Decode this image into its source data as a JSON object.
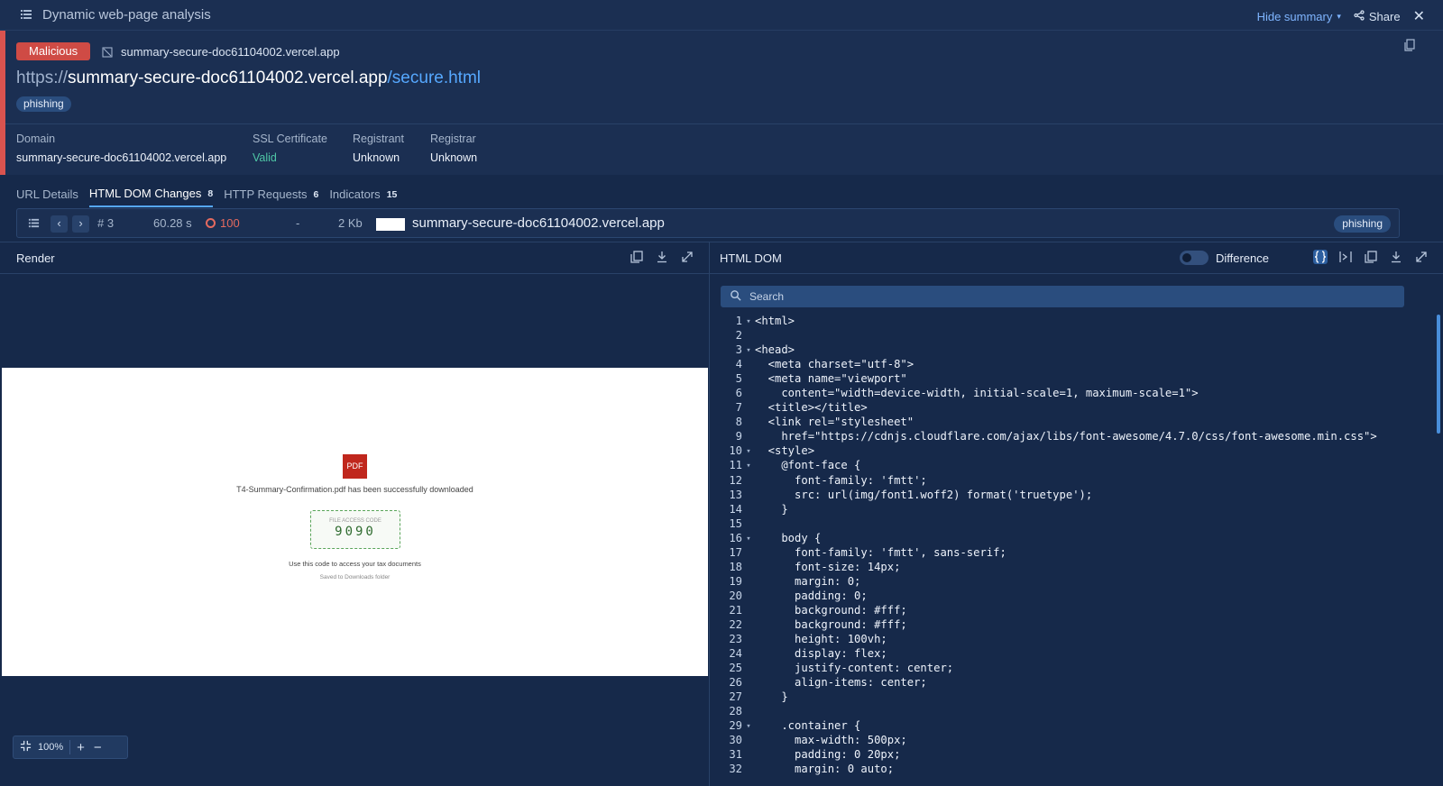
{
  "window": {
    "title": "Dynamic web-page analysis",
    "hide_summary": "Hide summary",
    "share": "Share",
    "colors": {
      "accent": "#56a8ff",
      "malicious": "#cf4b45",
      "valid": "#4fc7a6"
    }
  },
  "summary": {
    "verdict": "Malicious",
    "host": "summary-secure-doc61104002.vercel.app",
    "url_scheme": "https://",
    "url_host": "summary-secure-doc61104002.vercel.app",
    "url_path": "/secure.html",
    "tag": "phishing",
    "fields": [
      {
        "label": "Domain",
        "value": "summary-secure-doc61104002.vercel.app"
      },
      {
        "label": "SSL Certificate",
        "value": "Valid"
      },
      {
        "label": "Registrant",
        "value": "Unknown"
      },
      {
        "label": "Registrar",
        "value": "Unknown"
      }
    ]
  },
  "tabs": [
    {
      "label": "URL Details",
      "count": ""
    },
    {
      "label": "HTML DOM Changes",
      "count": "8"
    },
    {
      "label": "HTTP Requests",
      "count": "6"
    },
    {
      "label": "Indicators",
      "count": "15"
    }
  ],
  "navrow": {
    "index": "# 3",
    "time": "60.28 s",
    "score": "100",
    "dash": "-",
    "size": "2 Kb",
    "host": "summary-secure-doc61104002.vercel.app",
    "tag": "phishing"
  },
  "render": {
    "title": "Render",
    "pdf_label": "PDF",
    "download_msg": "T4-Summary-Confirmation.pdf has been successfully downloaded",
    "code_label": "FILE ACCESS CODE",
    "code_value": "9090",
    "use_msg": "Use this code to access your tax documents",
    "saved_msg": "Saved to Downloads folder",
    "zoom": "100%"
  },
  "dom": {
    "title": "HTML DOM",
    "difference": "Difference",
    "search_placeholder": "Search",
    "lines": [
      {
        "n": "1",
        "f": "▾",
        "t": "<html>"
      },
      {
        "n": "2",
        "f": "",
        "t": ""
      },
      {
        "n": "3",
        "f": "▾",
        "t": "<head>"
      },
      {
        "n": "4",
        "f": "",
        "t": "  <meta charset=\"utf-8\">"
      },
      {
        "n": "5",
        "f": "",
        "t": "  <meta name=\"viewport\""
      },
      {
        "n": "6",
        "f": "",
        "t": "    content=\"width=device-width, initial-scale=1, maximum-scale=1\">"
      },
      {
        "n": "7",
        "f": "",
        "t": "  <title></title>"
      },
      {
        "n": "8",
        "f": "",
        "t": "  <link rel=\"stylesheet\""
      },
      {
        "n": "9",
        "f": "",
        "t": "    href=\"https://cdnjs.cloudflare.com/ajax/libs/font-awesome/4.7.0/css/font-awesome.min.css\">"
      },
      {
        "n": "10",
        "f": "▾",
        "t": "  <style>"
      },
      {
        "n": "11",
        "f": "▾",
        "t": "    @font-face {"
      },
      {
        "n": "12",
        "f": "",
        "t": "      font-family: 'fmtt';"
      },
      {
        "n": "13",
        "f": "",
        "t": "      src: url(img/font1.woff2) format('truetype');"
      },
      {
        "n": "14",
        "f": "",
        "t": "    }"
      },
      {
        "n": "15",
        "f": "",
        "t": ""
      },
      {
        "n": "16",
        "f": "▾",
        "t": "    body {"
      },
      {
        "n": "17",
        "f": "",
        "t": "      font-family: 'fmtt', sans-serif;"
      },
      {
        "n": "18",
        "f": "",
        "t": "      font-size: 14px;"
      },
      {
        "n": "19",
        "f": "",
        "t": "      margin: 0;"
      },
      {
        "n": "20",
        "f": "",
        "t": "      padding: 0;"
      },
      {
        "n": "21",
        "f": "",
        "t": "      background: #fff;"
      },
      {
        "n": "22",
        "f": "",
        "t": "      background: #fff;"
      },
      {
        "n": "23",
        "f": "",
        "t": "      height: 100vh;"
      },
      {
        "n": "24",
        "f": "",
        "t": "      display: flex;"
      },
      {
        "n": "25",
        "f": "",
        "t": "      justify-content: center;"
      },
      {
        "n": "26",
        "f": "",
        "t": "      align-items: center;"
      },
      {
        "n": "27",
        "f": "",
        "t": "    }"
      },
      {
        "n": "28",
        "f": "",
        "t": ""
      },
      {
        "n": "29",
        "f": "▾",
        "t": "    .container {"
      },
      {
        "n": "30",
        "f": "",
        "t": "      max-width: 500px;"
      },
      {
        "n": "31",
        "f": "",
        "t": "      padding: 0 20px;"
      },
      {
        "n": "32",
        "f": "",
        "t": "      margin: 0 auto;"
      }
    ]
  }
}
